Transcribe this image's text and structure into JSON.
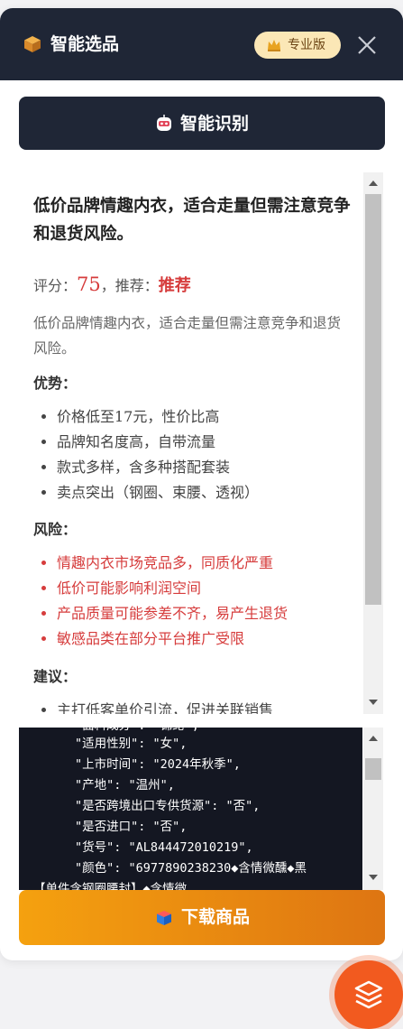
{
  "header": {
    "title": "智能选品",
    "badge": "专业版",
    "logo_icon": "box-icon",
    "close_icon": "close-icon"
  },
  "identify_button": {
    "label": "智能识别",
    "icon": "robot-icon"
  },
  "analysis": {
    "headline": "低价品牌情趣内衣，适合走量但需注意竞争和退货风险。",
    "score_label": "评分：",
    "score_value": "75",
    "recommend_label": "，推荐：",
    "recommend_value": "推荐",
    "summary": "低价品牌情趣内衣，适合走量但需注意竞争和退货风险。",
    "advantages_title": "优势：",
    "advantages": [
      "价格低至17元，性价比高",
      "品牌知名度高，自带流量",
      "款式多样，含多种搭配套装",
      "卖点突出（钢圈、束腰、透视）"
    ],
    "risks_title": "风险：",
    "risks": [
      "情趣内衣市场竞品多，同质化严重",
      "低价可能影响利润空间",
      "产品质量可能参差不齐，易产生退货",
      "敏感品类在部分平台推广受限"
    ],
    "suggestions_title": "建议：",
    "suggestions": [
      "主打低客单价引流，促进关联销售"
    ]
  },
  "code_panel": {
    "lines": [
      "\"适用性别\": \"女\",",
      "\"上市时间\": \"2024年秋季\",",
      "\"产地\": \"温州\",",
      "\"是否跨境出口专供货源\": \"否\",",
      "\"是否进口\": \"否\",",
      "\"货号\": \"AL844472010219\",",
      "\"颜色\": \"6977890238230◆含情微醺◆黑"
    ]
  },
  "download_button": {
    "label": "下载商品",
    "icon": "download-box-icon"
  },
  "fab": {
    "icon": "layers-icon"
  },
  "colors": {
    "header_bg": "#1f2636",
    "accent_red": "#d63c3c",
    "download_start": "#f5a10f",
    "download_end": "#de7512",
    "fab": "#f25a1f"
  }
}
